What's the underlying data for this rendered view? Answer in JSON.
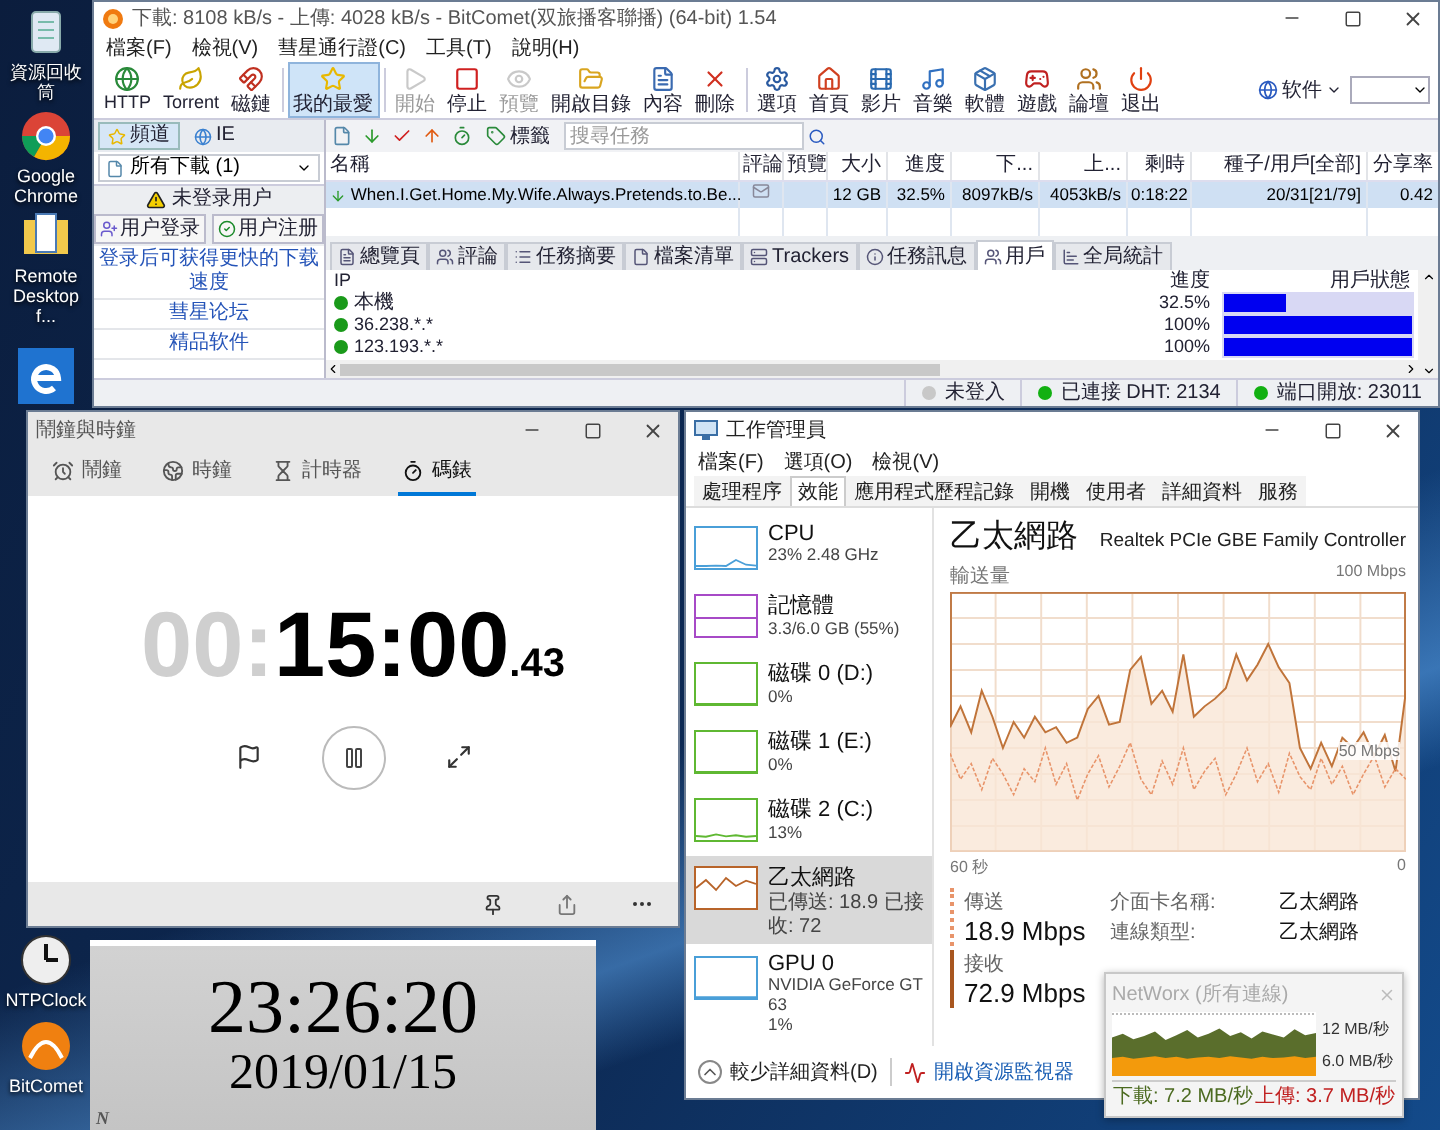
{
  "desktop_icons": [
    {
      "label": "資源回收筒"
    },
    {
      "label": "Google Chrome"
    },
    {
      "label": "Remote Desktop f..."
    },
    {
      "label": "NTPClock"
    },
    {
      "label": "BitComet"
    }
  ],
  "bitcomet": {
    "title": "下載: 8108 kB/s - 上傳: 4028 kB/s - BitComet(双旅播客聯播) (64-bit) 1.54",
    "menu": [
      "檔案(F)",
      "檢視(V)",
      "彗星通行證(C)",
      "工具(T)",
      "說明(H)"
    ],
    "toolbar": [
      {
        "label": "HTTP",
        "pressed": false,
        "disabled": false
      },
      {
        "label": "Torrent",
        "pressed": false,
        "disabled": false
      },
      {
        "label": "磁鏈",
        "pressed": false,
        "disabled": false
      },
      {
        "label": "我的最愛",
        "pressed": true,
        "disabled": false
      },
      {
        "label": "開始",
        "pressed": false,
        "disabled": true
      },
      {
        "label": "停止",
        "pressed": false,
        "disabled": false
      },
      {
        "label": "預覽",
        "pressed": false,
        "disabled": true
      },
      {
        "label": "開啟目錄",
        "pressed": false,
        "disabled": false
      },
      {
        "label": "內容",
        "pressed": false,
        "disabled": false
      },
      {
        "label": "刪除",
        "pressed": false,
        "disabled": false
      },
      {
        "label": "選項",
        "pressed": false,
        "disabled": false
      },
      {
        "label": "首頁",
        "pressed": false,
        "disabled": false
      },
      {
        "label": "影片",
        "pressed": false,
        "disabled": false
      },
      {
        "label": "音樂",
        "pressed": false,
        "disabled": false
      },
      {
        "label": "軟體",
        "pressed": false,
        "disabled": false
      },
      {
        "label": "遊戲",
        "pressed": false,
        "disabled": false
      },
      {
        "label": "論壇",
        "pressed": false,
        "disabled": false
      },
      {
        "label": "退出",
        "pressed": false,
        "disabled": false
      }
    ],
    "channel_menu": "软件",
    "left_tabs": [
      {
        "label": "頻道",
        "selected": true
      },
      {
        "label": "IE",
        "selected": false
      }
    ],
    "filter": "所有下載 (1)",
    "user_status": "未登录用户",
    "user_buttons": [
      "用户登录",
      "用户注册"
    ],
    "links": [
      "登录后可获得更快的下载速度",
      "彗星论坛",
      "精品软件"
    ],
    "tag_button": "標籤",
    "search": {
      "placeholder": "搜尋任務"
    },
    "task_columns": [
      "名稱",
      "評論",
      "預覽",
      "大小",
      "進度",
      "下...",
      "上...",
      "剩時",
      "種子/用戶[全部]",
      "分享率"
    ],
    "tasks": [
      {
        "name": "When.I.Get.Home.My.Wife.Always.Pretends.to.Be...",
        "size": "12 GB",
        "progress": "32.5%",
        "down": "8097kB/s",
        "up": "4053kB/s",
        "remaining": "0:18:22",
        "peers": "20/31[21/79]",
        "ratio": "0.42",
        "selected": true
      }
    ],
    "detail_tabs": [
      {
        "label": "總覽頁",
        "selected": false
      },
      {
        "label": "評論",
        "selected": false
      },
      {
        "label": "任務摘要",
        "selected": false
      },
      {
        "label": "檔案清單",
        "selected": false
      },
      {
        "label": "Trackers",
        "selected": false
      },
      {
        "label": "任務訊息",
        "selected": false
      },
      {
        "label": "用戶",
        "selected": true
      },
      {
        "label": "全局統計",
        "selected": false
      }
    ],
    "peer_columns": [
      "IP",
      "進度",
      "用戶狀態"
    ],
    "peers": [
      {
        "ip": "本機",
        "progress": "32.5%",
        "level": 0.325
      },
      {
        "ip": "36.238.*.*",
        "progress": "100%",
        "level": 1
      },
      {
        "ip": "123.193.*.*",
        "progress": "100%",
        "level": 1
      }
    ],
    "status_bar": [
      {
        "text": "未登入",
        "online": false
      },
      {
        "text": "已連接 DHT: 2134",
        "online": true
      },
      {
        "text": "端口開放: 23011",
        "online": true
      }
    ]
  },
  "clock": {
    "title": "鬧鐘與時鐘",
    "tabs": [
      {
        "label": "鬧鐘",
        "selected": false
      },
      {
        "label": "時鐘",
        "selected": false
      },
      {
        "label": "計時器",
        "selected": false
      },
      {
        "label": "碼錶",
        "selected": true
      }
    ],
    "hours": "00:",
    "minutes_seconds": "15:00",
    "hundredths": ".43"
  },
  "taskmgr": {
    "title": "工作管理員",
    "menu": [
      "檔案(F)",
      "選項(O)",
      "檢視(V)"
    ],
    "tabs": [
      {
        "label": "處理程序",
        "selected": false
      },
      {
        "label": "效能",
        "selected": true
      },
      {
        "label": "應用程式歷程記錄",
        "selected": false
      },
      {
        "label": "開機",
        "selected": false
      },
      {
        "label": "使用者",
        "selected": false
      },
      {
        "label": "詳細資料",
        "selected": false
      },
      {
        "label": "服務",
        "selected": false
      }
    ],
    "resources": [
      {
        "name": "CPU",
        "details": [
          "23% 2.48 GHz"
        ],
        "color": "#4a9fd8",
        "selected": false
      },
      {
        "name": "記憶體",
        "details": [
          "3.3/6.0 GB (55%)"
        ],
        "color": "#a74ac7",
        "selected": false
      },
      {
        "name": "磁碟 0 (D:)",
        "details": [
          "0%"
        ],
        "color": "#5fb832",
        "selected": false
      },
      {
        "name": "磁碟 1 (E:)",
        "details": [
          "0%"
        ],
        "color": "#5fb832",
        "selected": false
      },
      {
        "name": "磁碟 2 (C:)",
        "details": [
          "13%"
        ],
        "color": "#5fb832",
        "selected": false
      },
      {
        "name": "乙太網路",
        "details": [
          "已傳送: 18.9 已接收: 72"
        ],
        "color": "#b8642a",
        "selected": true
      },
      {
        "name": "GPU 0",
        "details": [
          "NVIDIA GeForce GT 63",
          "1%"
        ],
        "color": "#4a9fd8",
        "selected": false
      }
    ],
    "heading": "乙太網路",
    "adapter": "Realtek PCIe GBE Family Controller",
    "graph": {
      "label": "輸送量",
      "max": "100 Mbps",
      "mid": "50 Mbps",
      "start": "60 秒",
      "end": "0"
    },
    "send": {
      "label": "傳送",
      "value": "18.9 Mbps"
    },
    "receive": {
      "label": "接收",
      "value": "72.9 Mbps"
    },
    "properties": [
      {
        "label": "介面卡名稱:",
        "value": "乙太網路"
      },
      {
        "label": "連線類型:",
        "value": "乙太網路"
      }
    ],
    "less_details": "較少詳細資料(D)",
    "resource_monitor": "開啟資源監視器"
  },
  "networx": {
    "title": "NetWorx (所有連線)",
    "scale_top": "12 MB/秒",
    "scale_mid": "6.0 MB/秒",
    "download": "下載: 7.2 MB/秒",
    "upload": "上傳: 3.7 MB/秒"
  },
  "ntpclock": {
    "time": "23:26:20",
    "date": "2019/01/15",
    "corner_mark": "N"
  }
}
